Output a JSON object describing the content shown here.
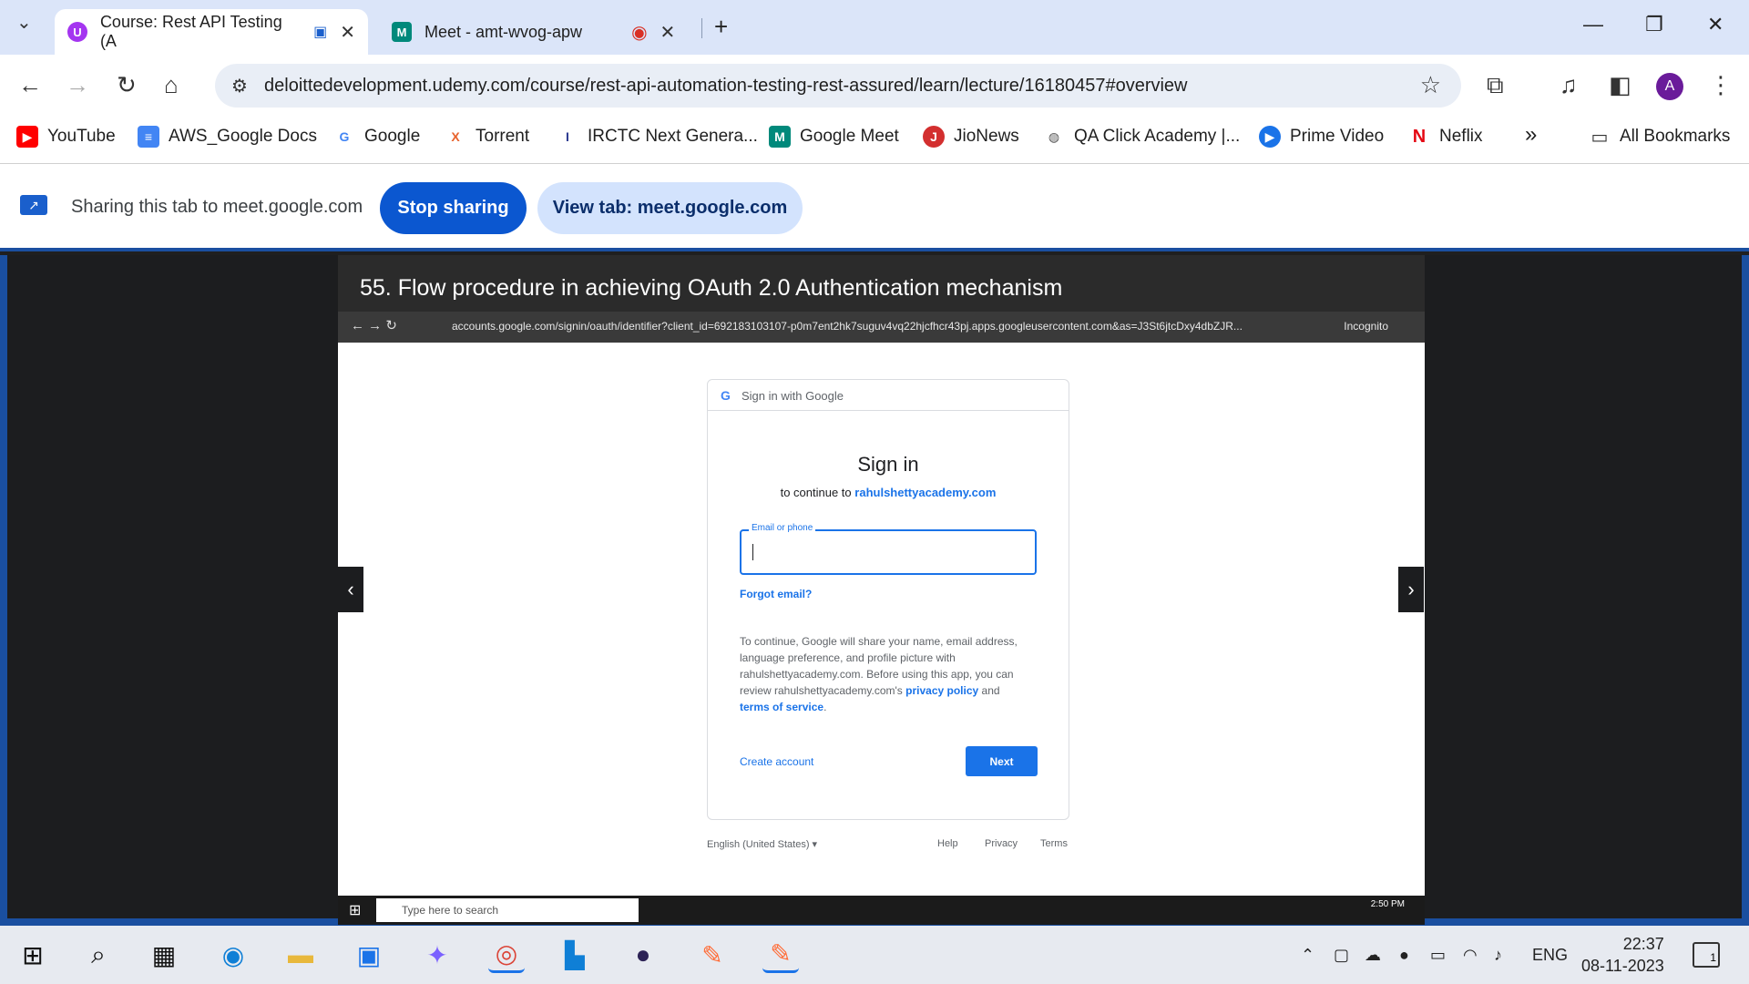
{
  "browser": {
    "tabs": [
      {
        "title": "Course: Rest API Testing (A",
        "favicon_letter": "U",
        "active": true
      },
      {
        "title": "Meet - amt-wvog-apw",
        "active": false
      }
    ],
    "new_tab_symbol": "+",
    "address": "deloittedevelopment.udemy.com/course/rest-api-automation-testing-rest-assured/learn/lecture/16180457#overview",
    "profile_initial": "A"
  },
  "bookmarks": [
    {
      "label": "YouTube",
      "color": "#ff0000",
      "glyph": "▶"
    },
    {
      "label": "AWS_Google Docs",
      "color": "#4285f4",
      "glyph": "≡"
    },
    {
      "label": "Google",
      "color": "#4285f4",
      "glyph": "G"
    },
    {
      "label": "Torrent",
      "color": "#e8622c",
      "glyph": "X"
    },
    {
      "label": "IRCTC Next Genera...",
      "color": "#2b3990",
      "glyph": "I"
    },
    {
      "label": "Google Meet",
      "color": "#00897b",
      "glyph": "M"
    },
    {
      "label": "JioNews",
      "color": "#d32f2f",
      "glyph": "J"
    },
    {
      "label": "QA Click Academy |...",
      "color": "#555555",
      "glyph": "◍"
    },
    {
      "label": "Prime Video",
      "color": "#1a73e8",
      "glyph": "▶"
    },
    {
      "label": "Neflix",
      "color": "#e50914",
      "glyph": "N"
    }
  ],
  "bookmarks_more": "»",
  "all_bookmarks": "All Bookmarks",
  "sharing": {
    "text": "Sharing this tab to meet.google.com",
    "stop_label": "Stop sharing",
    "view_label": "View tab: meet.google.com"
  },
  "video": {
    "title": "55. Flow procedure in achieving OAuth 2.0 Authentication mechanism",
    "inner_url": "accounts.google.com/signin/oauth/identifier?client_id=692183103107-p0m7ent2hk7suguv4vq22hjcfhcr43pj.apps.googleusercontent.com&as=J3St6jtcDxy4dbZJR...",
    "inner_incognito": "Incognito",
    "signin": {
      "header": "Sign in with Google",
      "title": "Sign in",
      "continue_prefix": "to continue to",
      "continue_site": "rahulshettyacademy.com",
      "email_label": "Email or phone",
      "forgot": "Forgot email?",
      "notice_1": "To continue, Google will share your name, email address, language preference, and profile picture with rahulshettyacademy.com. Before using this app, you can review rahulshettyacademy.com's",
      "privacy": "privacy policy",
      "and": "and",
      "terms": "terms of service",
      "period": ".",
      "create": "Create account",
      "next": "Next"
    },
    "footer": {
      "lang": "English (United States) ▾",
      "help": "Help",
      "privacy": "Privacy",
      "terms": "Terms"
    },
    "inner_search": "Type here to search",
    "inner_clock": "2:50 PM"
  },
  "taskbar": {
    "lang": "ENG",
    "time": "22:37",
    "date": "08-11-2023",
    "notif_count": "1"
  }
}
